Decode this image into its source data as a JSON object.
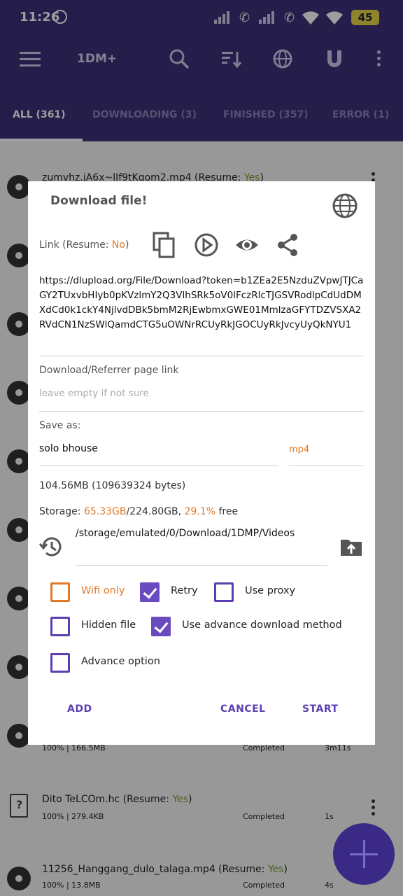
{
  "status_bar": {
    "time": "11:26",
    "battery": "45",
    "icons": [
      "alarm-icon",
      "signal-icon",
      "call-icon",
      "signal-icon",
      "call-icon",
      "wifi-icon",
      "wifi-icon",
      "battery-icon"
    ]
  },
  "app_bar": {
    "title": "1DM+",
    "icons": [
      "menu-icon",
      "search-icon",
      "sort-icon",
      "browser-icon",
      "magnet-icon",
      "more-icon"
    ]
  },
  "tabs": [
    {
      "label": "ALL (361)",
      "active": true
    },
    {
      "label": "DOWNLOADING (3)",
      "active": false
    },
    {
      "label": "FINISHED (357)",
      "active": false
    },
    {
      "label": "ERROR (1)",
      "active": false
    }
  ],
  "list": {
    "rows": [
      {
        "name": "zumvhz.jA6x~lIf9tKqom2.mp4 (Resume: ",
        "resume": "Yes",
        "suffix": ")",
        "meta": "",
        "status": "",
        "duration": ""
      },
      {
        "name": "",
        "resume": "",
        "suffix": "",
        "meta": "100% | 166.5MB",
        "status": "Completed",
        "duration": "3m11s"
      },
      {
        "name": "Dito TeLCOm.hc (Resume: ",
        "resume": "Yes",
        "suffix": ")",
        "meta": "100% | 279.4KB",
        "status": "Completed",
        "duration": "1s"
      },
      {
        "name": "11256_Hanggang_dulo_talaga.mp4 (Resume: ",
        "resume": "Yes",
        "suffix": ")",
        "meta": "100% | 13.8MB",
        "status": "Completed",
        "duration": "4s"
      }
    ]
  },
  "dialog": {
    "title": "Download file!",
    "link_label": "Link (Resume: ",
    "link_resume": "No",
    "link_suffix": ")",
    "url": "https://dlupload.org/File/Download?token=b1ZEa2E5NzduZVpwJTJCaGY2TUxvbHIyb0pKVzlmY2Q3VlhSRk5oV0lFczRlcTJGSVRodlpCdUdDMXdCd0k1ckY4NjlvdDBk5bmM2RjEwbmxGWE01MmlzaGFYTDZVSXA2RVdCN1NzSWlQamdCTG5uOWNrRCUyRkJGOCUyRkJvcyUyQkNYU1",
    "referrer_label": "Download/Referrer page link",
    "referrer_placeholder": "leave empty if not sure",
    "save_as_label": "Save as:",
    "filename": "solo bhouse",
    "extension": "mp4",
    "size": "104.56MB (109639324 bytes)",
    "storage_label": "Storage: ",
    "storage_free": "65.33GB",
    "storage_total": "/224.80GB, ",
    "storage_percent": "29.1%",
    "storage_suffix": " free",
    "path": "/storage/emulated/0/Download/1DMP/Videos",
    "options": {
      "wifi_only": {
        "label": "Wifi only",
        "checked": false
      },
      "retry": {
        "label": "Retry",
        "checked": true
      },
      "use_proxy": {
        "label": "Use proxy",
        "checked": false
      },
      "hidden_file": {
        "label": "Hidden file",
        "checked": false
      },
      "advance_method": {
        "label": "Use advance download method",
        "checked": true
      },
      "advance_option": {
        "label": "Advance option",
        "checked": false
      }
    },
    "buttons": {
      "add": "ADD",
      "cancel": "CANCEL",
      "start": "START"
    }
  },
  "colors": {
    "primary": "#3c2f78",
    "accent_orange": "#e07a2c",
    "check_purple": "#6a4bbf",
    "resume_yes": "#7aa02b"
  }
}
